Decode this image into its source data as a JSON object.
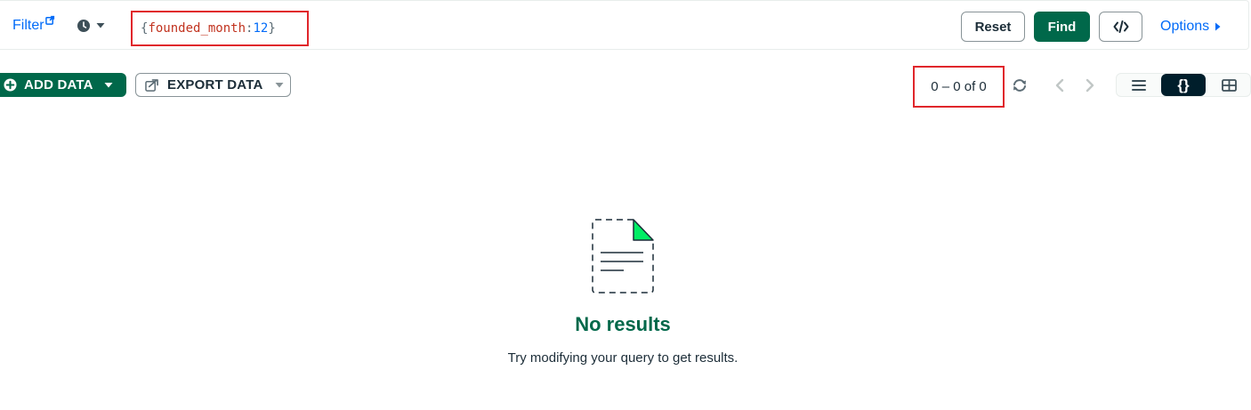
{
  "filter_bar": {
    "filter_label": "Filter",
    "query": {
      "open_brace": "{",
      "key": "founded_month",
      "colon": ":",
      "value": "12",
      "close_brace": "}"
    },
    "reset_label": "Reset",
    "find_label": "Find",
    "options_label": "Options"
  },
  "toolbar": {
    "add_data_label": "ADD DATA",
    "export_data_label": "EXPORT DATA",
    "pagination_text": "0 – 0 of 0",
    "view_json_label": "{}"
  },
  "empty_state": {
    "title": "No results",
    "subtitle": "Try modifying your query to get results."
  },
  "colors": {
    "brand_green": "#00684a",
    "link_blue": "#016bf8",
    "highlight_red": "#e0262b",
    "dark_navy": "#001e2b",
    "illustration_green": "#00ed64"
  }
}
